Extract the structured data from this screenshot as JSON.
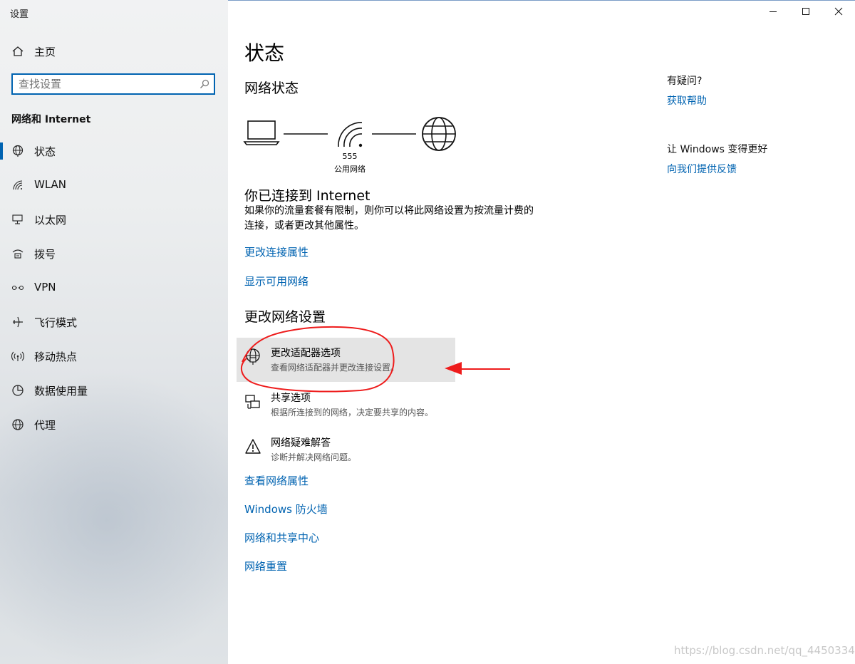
{
  "window": {
    "title": "设置"
  },
  "sidebar": {
    "home": "主页",
    "search_placeholder": "查找设置",
    "section": "网络和 Internet",
    "items": [
      {
        "label": "状态",
        "icon": "globe-status-icon",
        "active": true
      },
      {
        "label": "WLAN",
        "icon": "wifi-icon"
      },
      {
        "label": "以太网",
        "icon": "ethernet-icon"
      },
      {
        "label": "拨号",
        "icon": "dialup-icon"
      },
      {
        "label": "VPN",
        "icon": "vpn-icon"
      },
      {
        "label": "飞行模式",
        "icon": "airplane-icon"
      },
      {
        "label": "移动热点",
        "icon": "hotspot-icon"
      },
      {
        "label": "数据使用量",
        "icon": "data-usage-icon"
      },
      {
        "label": "代理",
        "icon": "globe-icon"
      }
    ]
  },
  "main": {
    "page_title": "状态",
    "network_status_heading": "网络状态",
    "network_name": "555",
    "network_type": "公用网络",
    "connected_heading": "你已连接到 Internet",
    "connected_desc": "如果你的流量套餐有限制，则你可以将此网络设置为按流量计费的连接，或者更改其他属性。",
    "links_top": [
      "更改连接属性",
      "显示可用网络"
    ],
    "change_heading": "更改网络设置",
    "options": [
      {
        "title": "更改适配器选项",
        "subtitle": "查看网络适配器并更改连接设置。",
        "icon": "adapter-icon"
      },
      {
        "title": "共享选项",
        "subtitle": "根据所连接到的网络，决定要共享的内容。",
        "icon": "sharing-icon"
      },
      {
        "title": "网络疑难解答",
        "subtitle": "诊断并解决网络问题。",
        "icon": "warning-icon"
      }
    ],
    "links_bottom": [
      "查看网络属性",
      "Windows 防火墙",
      "网络和共享中心",
      "网络重置"
    ]
  },
  "right": {
    "question": "有疑问?",
    "help_link": "获取帮助",
    "improve": "让 Windows 变得更好",
    "feedback_link": "向我们提供反馈"
  },
  "watermark": "https://blog.csdn.net/qq_44503344",
  "colors": {
    "accent": "#0063b1",
    "annotation": "#ee1c1c"
  }
}
